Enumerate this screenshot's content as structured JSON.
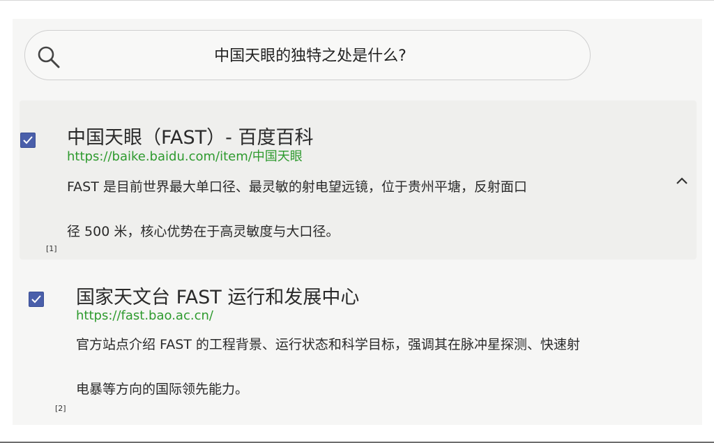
{
  "search": {
    "query": "中国天眼的独特之处是什么?"
  },
  "results": [
    {
      "title": "中国天眼（FAST）- 百度百科",
      "url": "https://baike.baidu.com/item/中国天眼",
      "snippet_line1": "FAST 是目前世界最大单口径、最灵敏的射电望远镜，位于贵州平塘，反射面口",
      "snippet_line2": "径 500 米，核心优势在于高灵敏度与大口径。",
      "ref": "[1]",
      "checked": true
    },
    {
      "title": "国家天文台 FAST 运行和发展中心",
      "url": "https://fast.bao.ac.cn/",
      "snippet_line1": "官方站点介绍 FAST 的工程背景、运行状态和科学目标，强调其在脉冲星探测、快速射",
      "snippet_line2": "电暴等方向的国际领先能力。",
      "ref": "[2]",
      "checked": true
    }
  ],
  "colors": {
    "url_green": "#2e9a2e",
    "checkbox_blue": "#4a5faa",
    "highlight_bg": "#efefed"
  },
  "icons": {
    "search": "search-icon",
    "checkbox": "checkmark-icon",
    "collapse": "chevron-up-icon"
  }
}
